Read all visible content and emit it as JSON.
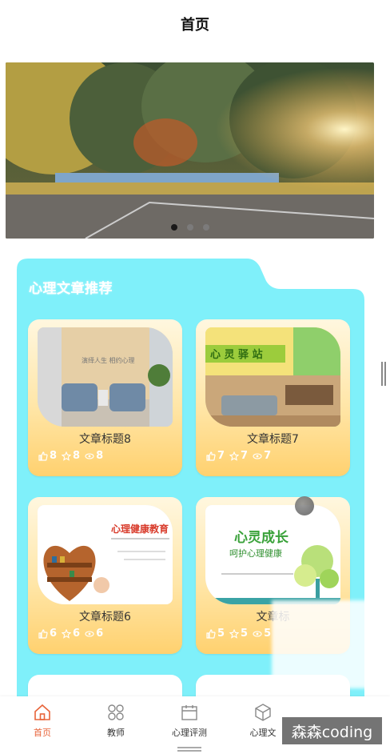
{
  "header": {
    "title": "首页"
  },
  "banner": {
    "slides": 3,
    "active_index": 0
  },
  "section": {
    "title": "心理文章推荐"
  },
  "articles": [
    {
      "title": "文章标题8",
      "likes": "8",
      "favorites": "8",
      "views": "8"
    },
    {
      "title": "文章标题7",
      "likes": "7",
      "favorites": "7",
      "views": "7"
    },
    {
      "title": "文章标题6",
      "likes": "6",
      "favorites": "6",
      "views": "6"
    },
    {
      "title": "文章标",
      "likes": "5",
      "favorites": "5",
      "views": "5"
    }
  ],
  "thumbs": {
    "t1": {
      "sign_text": "演绎人生  相约心理"
    },
    "t2": {
      "banner_text": "心 灵 驿 站"
    },
    "t3": {
      "heading": "心理健康教育"
    },
    "t4": {
      "line1": "心灵成长",
      "line2": "呵护心理健康"
    }
  },
  "tabs": [
    {
      "label": "首页",
      "icon": "home-icon",
      "active": true
    },
    {
      "label": "教师",
      "icon": "grid-icon",
      "active": false
    },
    {
      "label": "心理评测",
      "icon": "calendar-icon",
      "active": false
    },
    {
      "label": "心理文",
      "icon": "cube-icon",
      "active": false
    }
  ],
  "watermark": {
    "text": "森森coding"
  },
  "colors": {
    "accent": "#e8643a",
    "section_bg": "#7ff0fa",
    "card_bottom": "#ffd16f"
  }
}
